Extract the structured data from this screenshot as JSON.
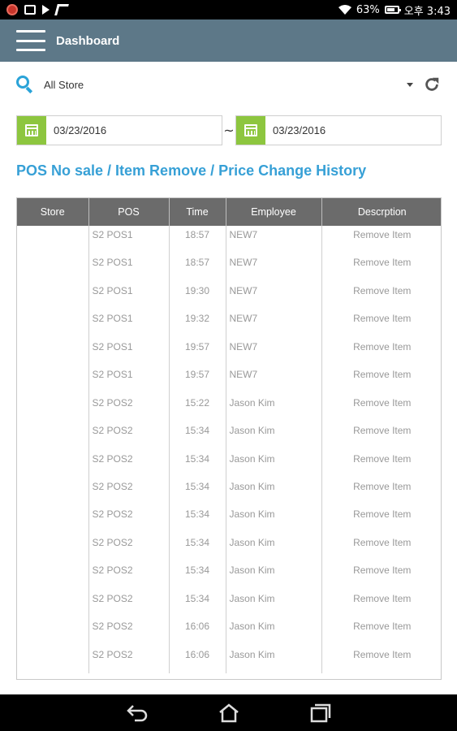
{
  "status_bar": {
    "battery_percent": "63%",
    "time": "오후 3:43",
    "battery_level": 0.63
  },
  "app_bar": {
    "title": "Dashboard"
  },
  "filter": {
    "store_value": "All Store"
  },
  "date_range": {
    "start": "03/23/2016",
    "separator": "~",
    "end": "03/23/2016"
  },
  "section_title": "POS No sale / Item Remove / Price Change History",
  "table": {
    "headers": [
      "Store",
      "POS",
      "Time",
      "Employee",
      "Descrption"
    ],
    "rows": [
      {
        "store": "",
        "pos": "S2 POS1",
        "time": "18:57",
        "employee": "NEW7",
        "description": "Remove Item"
      },
      {
        "store": "",
        "pos": "S2 POS1",
        "time": "18:57",
        "employee": "NEW7",
        "description": "Remove Item"
      },
      {
        "store": "",
        "pos": "S2 POS1",
        "time": "19:30",
        "employee": "NEW7",
        "description": "Remove Item"
      },
      {
        "store": "",
        "pos": "S2 POS1",
        "time": "19:32",
        "employee": "NEW7",
        "description": "Remove Item"
      },
      {
        "store": "",
        "pos": "S2 POS1",
        "time": "19:57",
        "employee": "NEW7",
        "description": "Remove Item"
      },
      {
        "store": "",
        "pos": "S2 POS1",
        "time": "19:57",
        "employee": "NEW7",
        "description": "Remove Item"
      },
      {
        "store": "",
        "pos": "S2 POS2",
        "time": "15:22",
        "employee": "Jason Kim",
        "description": "Remove Item"
      },
      {
        "store": "",
        "pos": "S2 POS2",
        "time": "15:34",
        "employee": "Jason Kim",
        "description": "Remove Item"
      },
      {
        "store": "",
        "pos": "S2 POS2",
        "time": "15:34",
        "employee": "Jason Kim",
        "description": "Remove Item"
      },
      {
        "store": "",
        "pos": "S2 POS2",
        "time": "15:34",
        "employee": "Jason Kim",
        "description": "Remove Item"
      },
      {
        "store": "",
        "pos": "S2 POS2",
        "time": "15:34",
        "employee": "Jason Kim",
        "description": "Remove Item"
      },
      {
        "store": "",
        "pos": "S2 POS2",
        "time": "15:34",
        "employee": "Jason Kim",
        "description": "Remove Item"
      },
      {
        "store": "",
        "pos": "S2 POS2",
        "time": "15:34",
        "employee": "Jason Kim",
        "description": "Remove Item"
      },
      {
        "store": "",
        "pos": "S2 POS2",
        "time": "15:34",
        "employee": "Jason Kim",
        "description": "Remove Item"
      },
      {
        "store": "",
        "pos": "S2 POS2",
        "time": "16:06",
        "employee": "Jason Kim",
        "description": "Remove Item"
      },
      {
        "store": "",
        "pos": "S2 POS2",
        "time": "16:06",
        "employee": "Jason Kim",
        "description": "Remove Item"
      }
    ]
  },
  "icons": {
    "status_left": [
      "recorder-icon",
      "card-icon",
      "play-store-icon",
      "store-icon"
    ],
    "status_right": [
      "wifi-icon",
      "battery-icon"
    ],
    "nav": [
      "back-icon",
      "home-icon",
      "recents-icon"
    ]
  },
  "colors": {
    "app_bar": "#5d7888",
    "accent_blue": "#37a0d6",
    "calendar_green": "#8dc63f",
    "table_header": "#6b6b6b"
  }
}
